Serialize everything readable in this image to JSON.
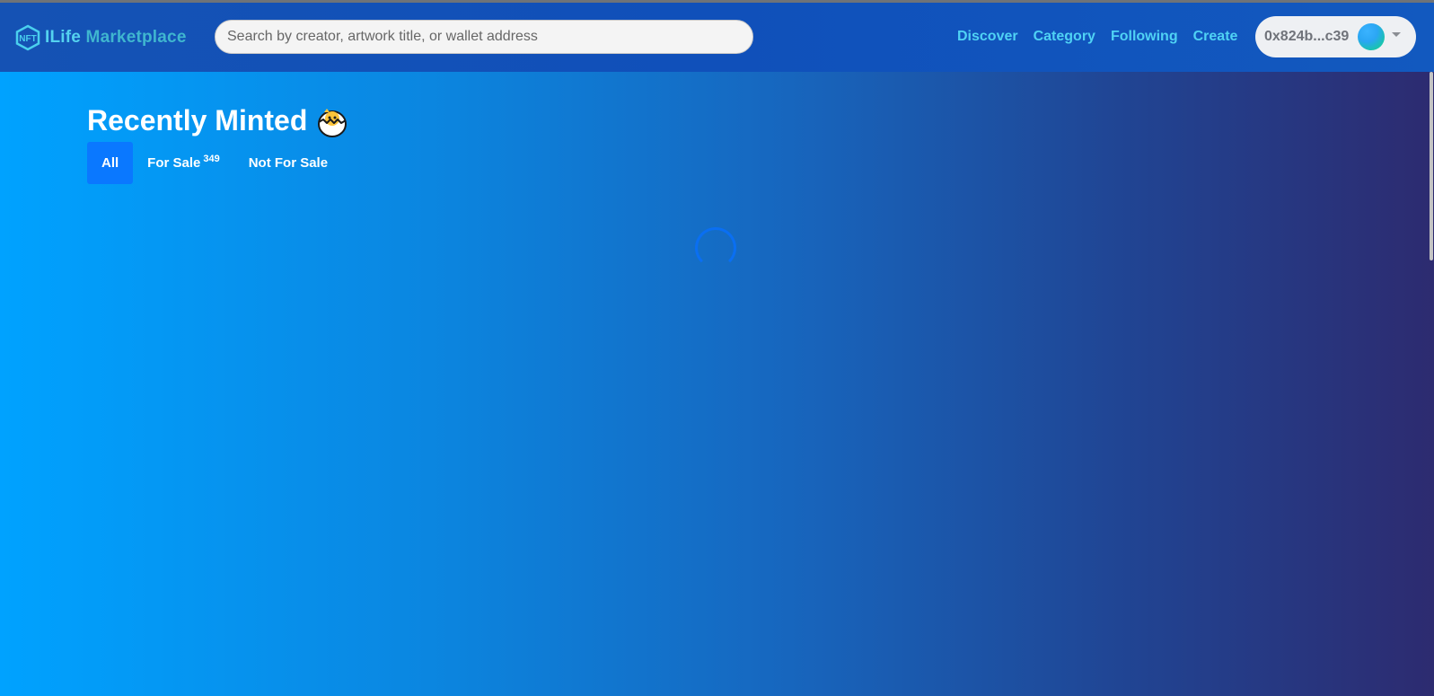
{
  "brand": {
    "first": "ILife",
    "second": "Marketplace",
    "logo_icon": "nft-hexagon-icon"
  },
  "search": {
    "placeholder": "Search by creator, artwork title, or wallet address",
    "value": ""
  },
  "nav": {
    "links": [
      {
        "label": "Discover"
      },
      {
        "label": "Category"
      },
      {
        "label": "Following"
      },
      {
        "label": "Create"
      }
    ]
  },
  "wallet": {
    "address": "0x824b...c39",
    "avatar_icon": "gradient-avatar",
    "caret_icon": "chevron-down-icon"
  },
  "main": {
    "title": "Recently Minted",
    "title_icon": "hatching-chick-icon",
    "tabs": [
      {
        "label": "All",
        "active": true,
        "count": ""
      },
      {
        "label": "For Sale",
        "active": false,
        "count": "349"
      },
      {
        "label": "Not For Sale",
        "active": false,
        "count": ""
      }
    ],
    "loading_icon": "loading-spinner-icon"
  },
  "colors": {
    "nav_bg": "#1050ba",
    "nav_link": "#4fd2f4",
    "brand_text": "#49c7e6",
    "active_tab": "#0a78ff",
    "spinner": "#0a6ff2"
  }
}
